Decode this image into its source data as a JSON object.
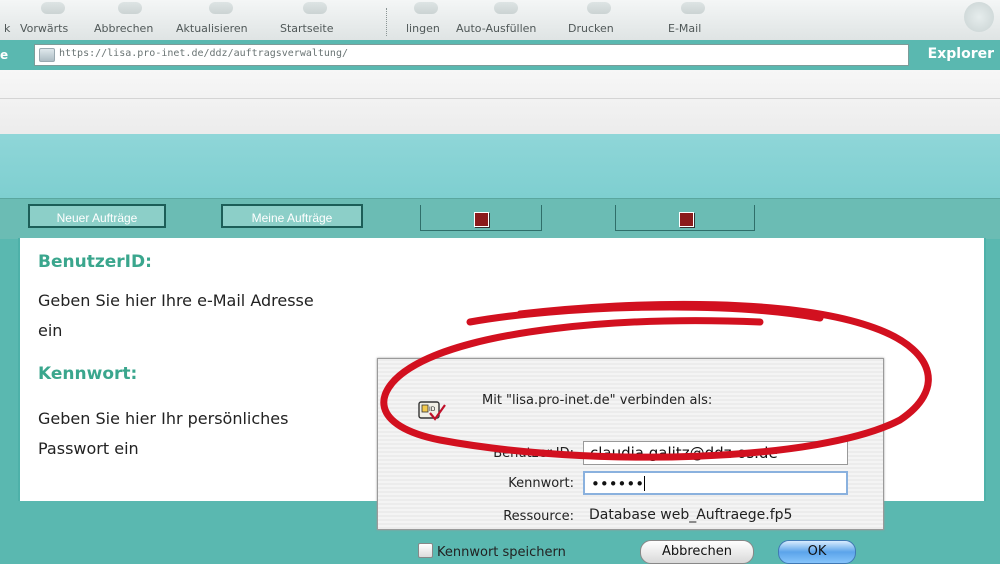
{
  "toolbar": {
    "items": [
      {
        "label": "k",
        "x": 0
      },
      {
        "label": "Vorwärts"
      },
      {
        "label": "Abbrechen"
      },
      {
        "label": "Aktualisieren"
      },
      {
        "label": "Startseite"
      },
      {
        "label": "lingen"
      },
      {
        "label": "Auto-Ausfüllen"
      },
      {
        "label": "Drucken"
      },
      {
        "label": "E-Mail"
      }
    ]
  },
  "address_bar": {
    "label_cut": "e",
    "url": "https://lisa.pro-inet.de/ddz/auftragsverwaltung/",
    "explorer_label": "Explorer"
  },
  "nav": {
    "new_orders": "Neuer Aufträge",
    "my_orders": "Meine Aufträge"
  },
  "help": {
    "user_heading": "BenutzerID:",
    "user_text": "Geben Sie hier Ihre e-Mail Adresse ein",
    "password_heading": "Kennwort:",
    "password_text": "Geben Sie hier Ihr persönliches Passwort ein"
  },
  "dialog": {
    "message": "Mit \"lisa.pro-inet.de\" verbinden als:",
    "user_label": "Benutzer-ID:",
    "user_value": "claudia.galitz@ddz-os.de",
    "password_label": "Kennwort:",
    "password_value": "••••••",
    "resource_label": "Ressource:",
    "resource_value": "Database web_Auftraege.fp5",
    "save_password_label": "Kennwort speichern",
    "cancel_label": "Abbrechen",
    "ok_label": "OK"
  }
}
